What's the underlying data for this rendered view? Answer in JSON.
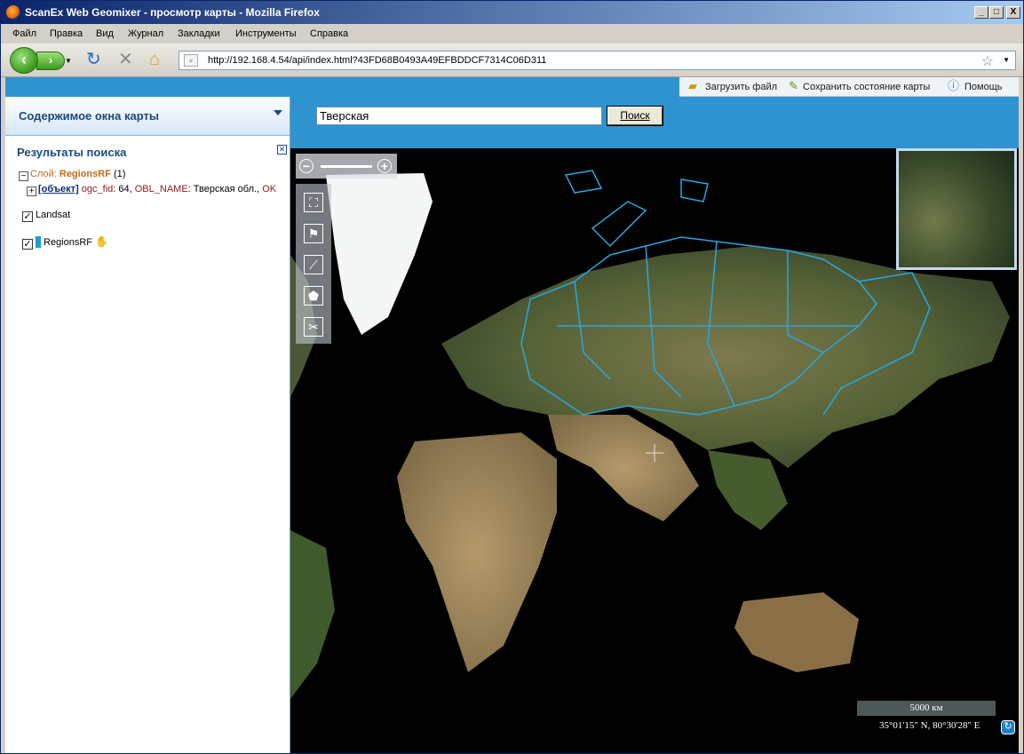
{
  "window": {
    "title": "ScanEx Web Geomixer - просмотр карты - Mozilla Firefox",
    "controls": [
      "_",
      "□",
      "X"
    ]
  },
  "menu": [
    "Файл",
    "Правка",
    "Вид",
    "Журнал",
    "Закладки",
    "Инструменты",
    "Справка"
  ],
  "address": {
    "url": "http://192.168.4.54/api/index.html?43FD68B0493A49EFBDDCF7314C06D311"
  },
  "toolbar": {
    "upload": "Загрузить файл",
    "save_state": "Сохранить состояние карты",
    "help": "Помощь"
  },
  "search": {
    "value": "Тверская",
    "button": "Поиск"
  },
  "sidebar": {
    "header": "Содержимое окна карты",
    "results_title": "Результаты поиска",
    "layer_prefix": "Слой:",
    "layer_name": "RegionsRF",
    "layer_count": "(1)",
    "object_link": "[объект]",
    "attr1_key": "ogc_fid",
    "attr1_val": ": 64,",
    "attr2_key": "OBL_NAME",
    "attr2_val": ": Тверская обл.,",
    "attr3_key": "OK",
    "layers": [
      {
        "name": "Landsat",
        "checked": true
      },
      {
        "name": "RegionsRF",
        "checked": true,
        "color": "#1b9fd6"
      }
    ]
  },
  "map": {
    "scale": "5000 км",
    "coords": "35°01'15\" N, 80°30'28\" E",
    "boundary_color": "#2aa6e0"
  }
}
